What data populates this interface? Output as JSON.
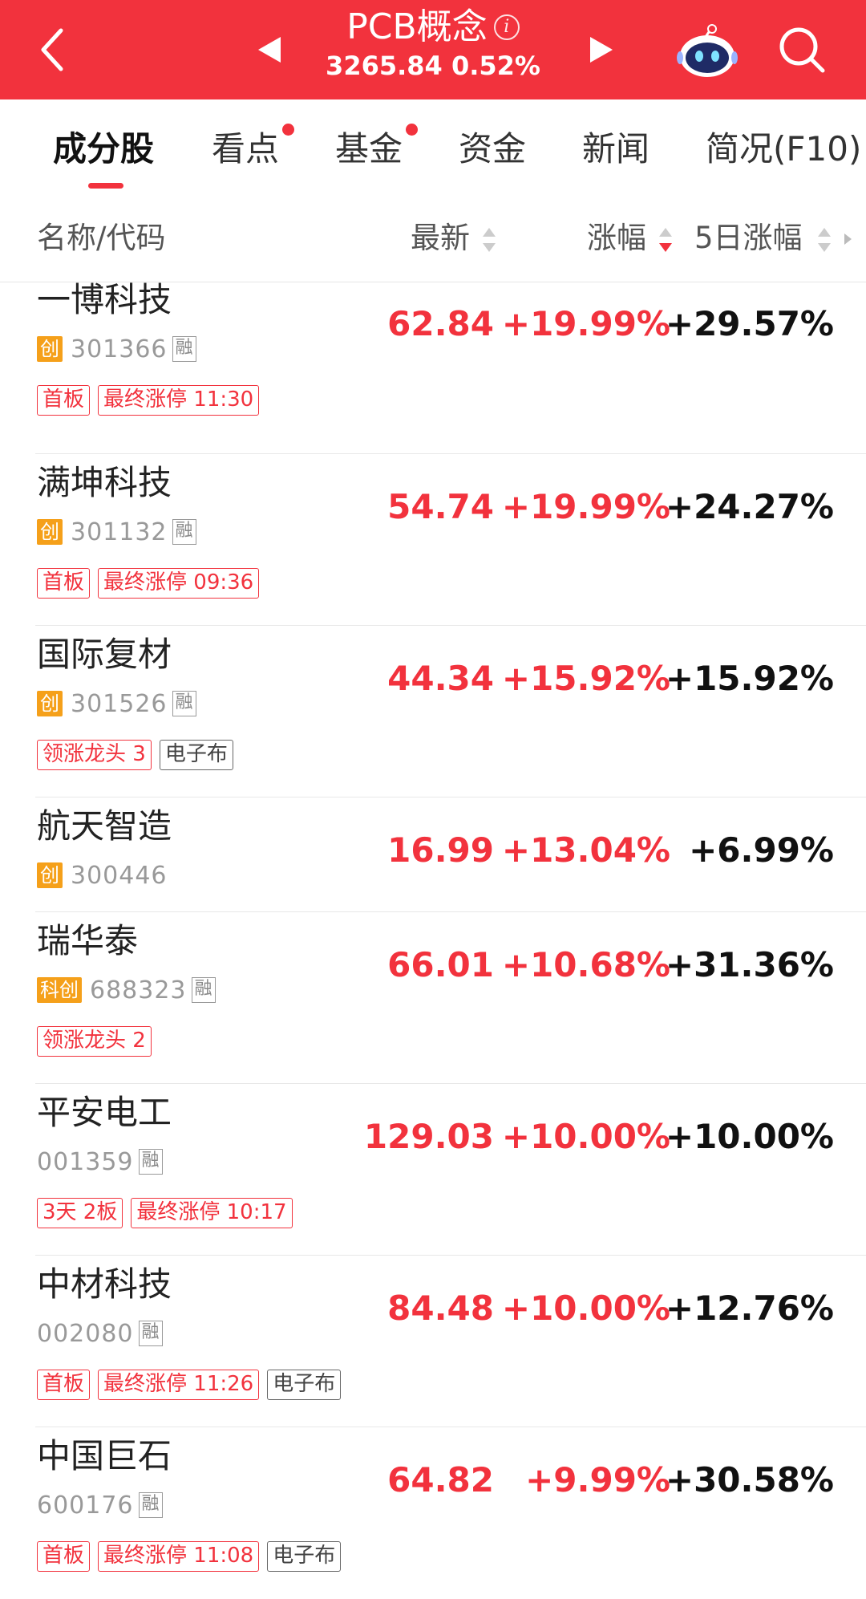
{
  "header": {
    "title": "PCB概念",
    "index_value": "3265.84",
    "index_change": "0.52%",
    "colors": {
      "brand": "#f2323d",
      "rise": "#f2323d",
      "board_badge": "#f5a01a"
    }
  },
  "tabs": [
    {
      "label": "成分股",
      "active": true,
      "dot": false
    },
    {
      "label": "看点",
      "active": false,
      "dot": true
    },
    {
      "label": "基金",
      "active": false,
      "dot": true
    },
    {
      "label": "资金",
      "active": false,
      "dot": false
    },
    {
      "label": "新闻",
      "active": false,
      "dot": false
    },
    {
      "label": "简况(F10)",
      "active": false,
      "dot": false
    }
  ],
  "columns": {
    "name": "名称/代码",
    "latest": "最新",
    "change": "涨幅",
    "change5d": "5日涨幅"
  },
  "stocks": [
    {
      "name": "一博科技",
      "board": "创",
      "code": "301366",
      "margin": "融",
      "price": "62.84",
      "change": "+19.99%",
      "change5d": "+29.57%",
      "tags": [
        {
          "text": "首板",
          "style": "red"
        },
        {
          "text": "最终涨停 11:30",
          "style": "red"
        }
      ]
    },
    {
      "name": "满坤科技",
      "board": "创",
      "code": "301132",
      "margin": "融",
      "price": "54.74",
      "change": "+19.99%",
      "change5d": "+24.27%",
      "tags": [
        {
          "text": "首板",
          "style": "red"
        },
        {
          "text": "最终涨停 09:36",
          "style": "red"
        }
      ]
    },
    {
      "name": "国际复材",
      "board": "创",
      "code": "301526",
      "margin": "融",
      "price": "44.34",
      "change": "+15.92%",
      "change5d": "+15.92%",
      "tags": [
        {
          "text": "领涨龙头 3",
          "style": "red"
        },
        {
          "text": "电子布",
          "style": "gray"
        }
      ]
    },
    {
      "name": "航天智造",
      "board": "创",
      "code": "300446",
      "margin": "",
      "price": "16.99",
      "change": "+13.04%",
      "change5d": "+6.99%",
      "tags": []
    },
    {
      "name": "瑞华泰",
      "board": "科创",
      "code": "688323",
      "margin": "融",
      "price": "66.01",
      "change": "+10.68%",
      "change5d": "+31.36%",
      "tags": [
        {
          "text": "领涨龙头 2",
          "style": "red"
        }
      ]
    },
    {
      "name": "平安电工",
      "board": "",
      "code": "001359",
      "margin": "融",
      "price": "129.03",
      "change": "+10.00%",
      "change5d": "+10.00%",
      "tags": [
        {
          "text": "3天 2板",
          "style": "red"
        },
        {
          "text": "最终涨停 10:17",
          "style": "red"
        }
      ]
    },
    {
      "name": "中材科技",
      "board": "",
      "code": "002080",
      "margin": "融",
      "price": "84.48",
      "change": "+10.00%",
      "change5d": "+12.76%",
      "tags": [
        {
          "text": "首板",
          "style": "red"
        },
        {
          "text": "最终涨停 11:26",
          "style": "red"
        },
        {
          "text": "电子布",
          "style": "gray"
        }
      ]
    },
    {
      "name": "中国巨石",
      "board": "",
      "code": "600176",
      "margin": "融",
      "price": "64.82",
      "change": "+9.99%",
      "change5d": "+30.58%",
      "tags": [
        {
          "text": "首板",
          "style": "red"
        },
        {
          "text": "最终涨停 11:08",
          "style": "red"
        },
        {
          "text": "电子布",
          "style": "gray"
        }
      ]
    }
  ]
}
